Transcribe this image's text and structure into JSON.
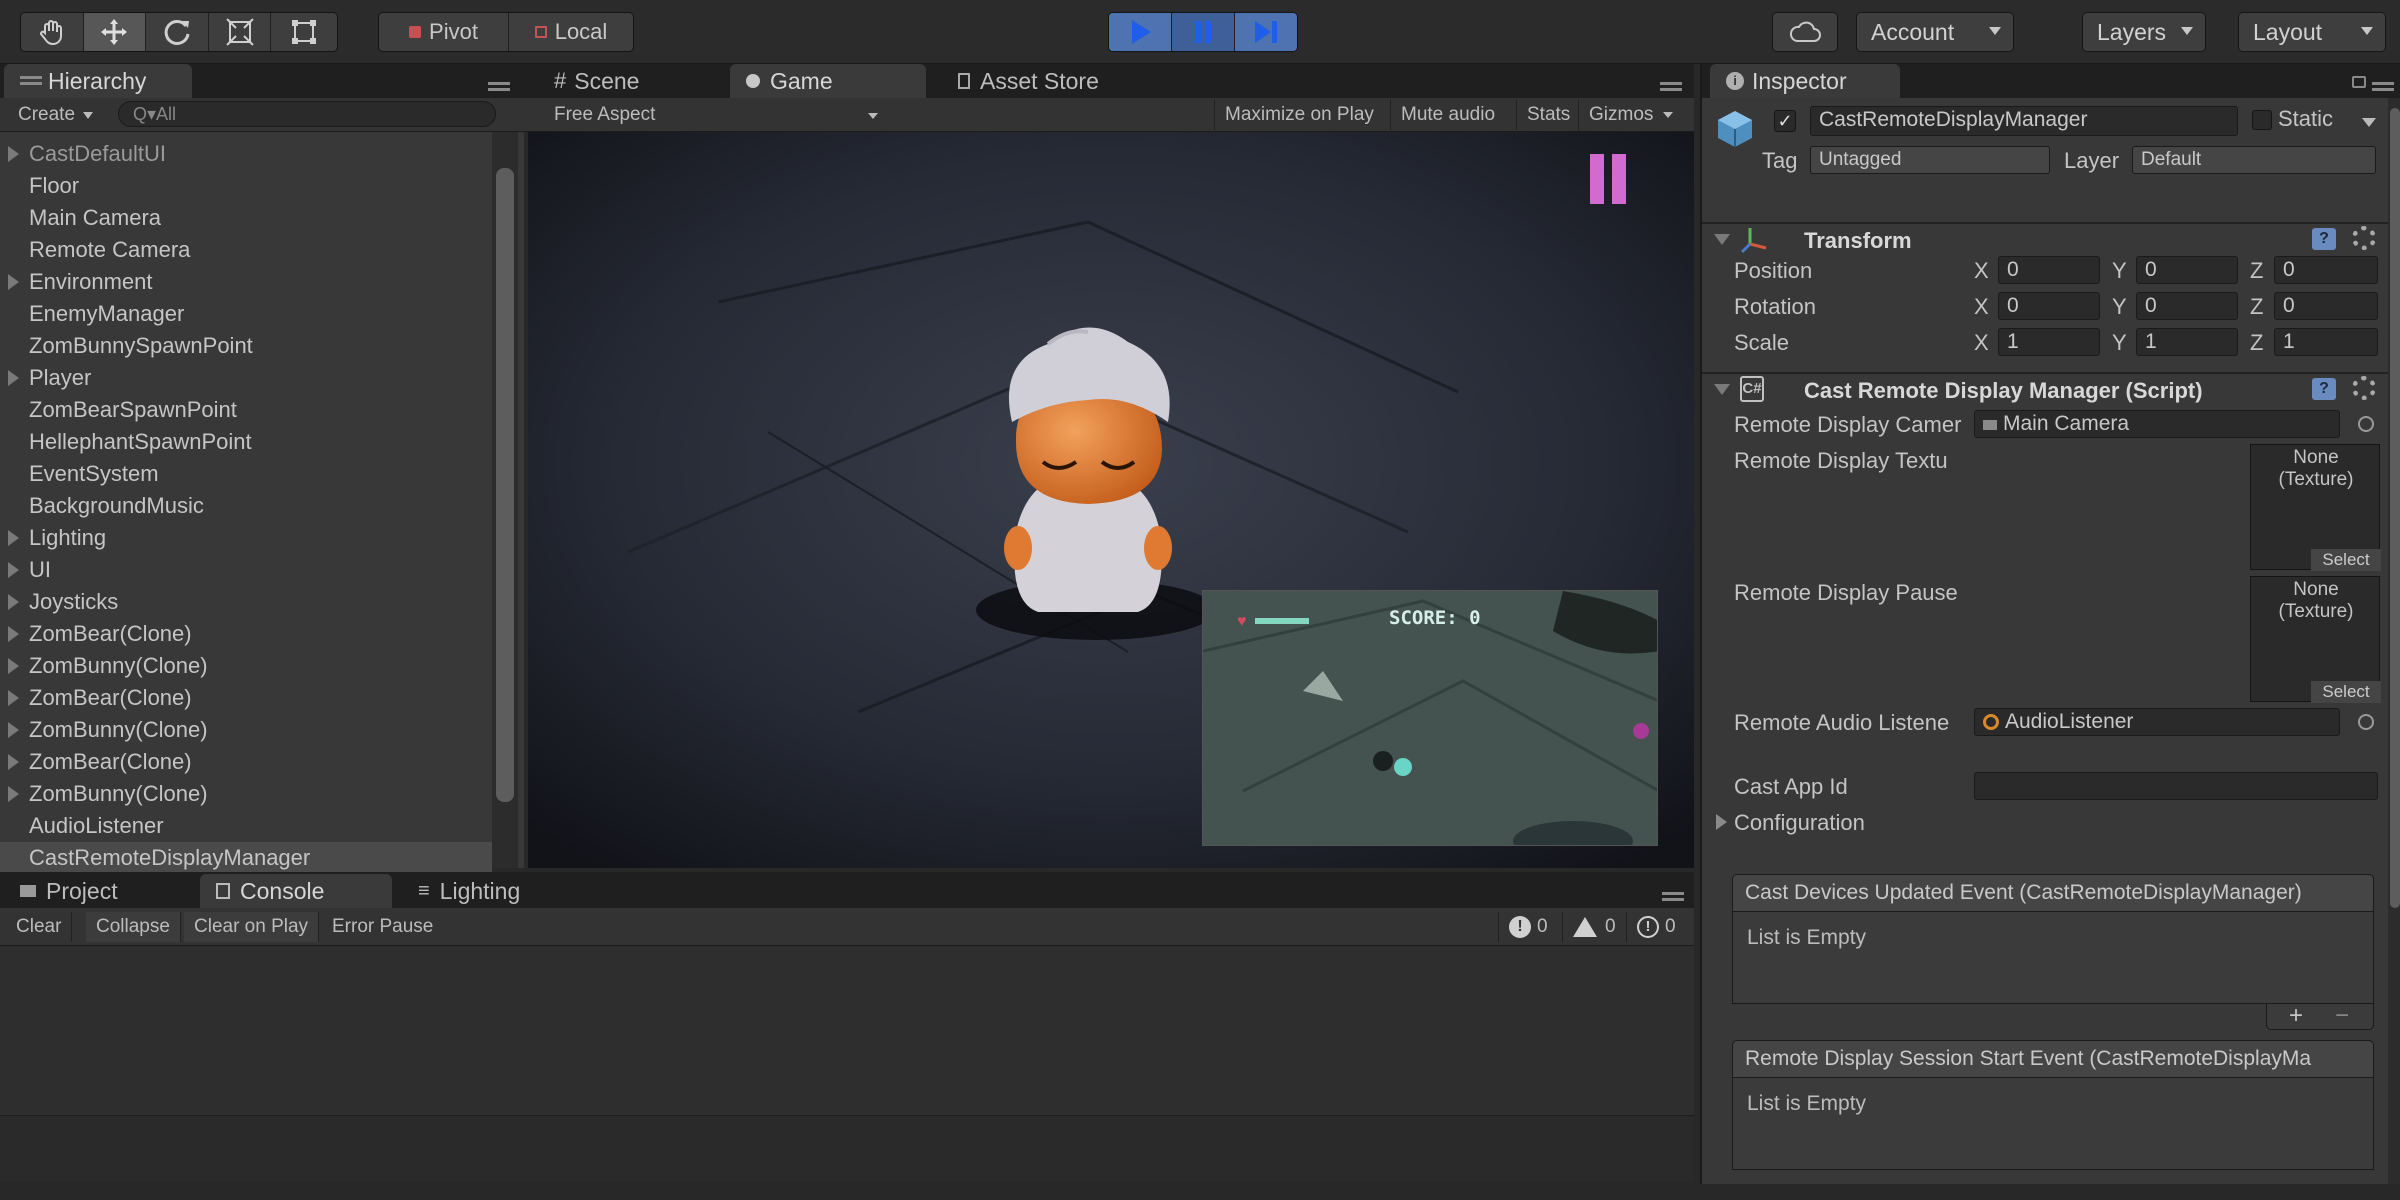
{
  "toolbar": {
    "pivot_label": "Pivot",
    "local_label": "Local",
    "account_label": "Account",
    "layers_label": "Layers",
    "layout_label": "Layout",
    "tools": [
      "hand-tool-icon",
      "move-tool-icon",
      "rotate-tool-icon",
      "scale-tool-icon",
      "rect-tool-icon"
    ],
    "play_icon": "play-icon",
    "pause_icon": "pause-icon",
    "step_icon": "step-icon",
    "cloud_icon": "cloud-icon"
  },
  "hierarchy": {
    "tab_label": "Hierarchy",
    "create_label": "Create",
    "search_placeholder": "Q▾All",
    "items": [
      {
        "label": "CastDefaultUI",
        "expandable": true,
        "dim": true
      },
      {
        "label": "Floor",
        "expandable": false
      },
      {
        "label": "Main Camera",
        "expandable": false
      },
      {
        "label": "Remote Camera",
        "expandable": false
      },
      {
        "label": "Environment",
        "expandable": true
      },
      {
        "label": "EnemyManager",
        "expandable": false
      },
      {
        "label": "ZomBunnySpawnPoint",
        "expandable": false
      },
      {
        "label": "Player",
        "expandable": true
      },
      {
        "label": "ZomBearSpawnPoint",
        "expandable": false
      },
      {
        "label": "HellephantSpawnPoint",
        "expandable": false
      },
      {
        "label": "EventSystem",
        "expandable": false
      },
      {
        "label": "BackgroundMusic",
        "expandable": false
      },
      {
        "label": "Lighting",
        "expandable": true
      },
      {
        "label": "UI",
        "expandable": true
      },
      {
        "label": "Joysticks",
        "expandable": true
      },
      {
        "label": "ZomBear(Clone)",
        "expandable": true
      },
      {
        "label": "ZomBunny(Clone)",
        "expandable": true
      },
      {
        "label": "ZomBear(Clone)",
        "expandable": true
      },
      {
        "label": "ZomBunny(Clone)",
        "expandable": true
      },
      {
        "label": "ZomBear(Clone)",
        "expandable": true
      },
      {
        "label": "ZomBunny(Clone)",
        "expandable": true
      },
      {
        "label": "AudioListener",
        "expandable": false
      },
      {
        "label": "CastRemoteDisplayManager",
        "expandable": false,
        "selected": true
      }
    ]
  },
  "center": {
    "tabs": [
      {
        "label": "Scene",
        "icon": "scene-icon"
      },
      {
        "label": "Game",
        "icon": "game-icon",
        "active": true
      },
      {
        "label": "Asset Store",
        "icon": "store-icon"
      }
    ],
    "aspect_label": "Free Aspect",
    "maximize_label": "Maximize on Play",
    "mute_label": "Mute audio",
    "stats_label": "Stats",
    "gizmos_label": "Gizmos",
    "inset_score": "SCORE: 0",
    "inset_health": 0.9
  },
  "console": {
    "tabs": [
      {
        "label": "Project",
        "icon": "folder-icon"
      },
      {
        "label": "Console",
        "icon": "console-icon",
        "active": true
      },
      {
        "label": "Lighting",
        "icon": "lighting-icon"
      }
    ],
    "buttons": [
      "Clear",
      "Collapse",
      "Clear on Play",
      "Error Pause"
    ],
    "counts": {
      "info": "0",
      "warning": "0",
      "error": "0"
    }
  },
  "inspector": {
    "tab_label": "Inspector",
    "object_name": "CastRemoteDisplayManager",
    "static_label": "Static",
    "tag_label": "Tag",
    "tag_value": "Untagged",
    "layer_label": "Layer",
    "layer_value": "Default",
    "transform": {
      "title": "Transform",
      "rows": [
        {
          "label": "Position",
          "x": "0",
          "y": "0",
          "z": "0"
        },
        {
          "label": "Rotation",
          "x": "0",
          "y": "0",
          "z": "0"
        },
        {
          "label": "Scale",
          "x": "1",
          "y": "1",
          "z": "1"
        }
      ],
      "axis_x": "X",
      "axis_y": "Y",
      "axis_z": "Z"
    },
    "script": {
      "title": "Cast Remote Display Manager (Script)",
      "remote_camera_label": "Remote Display Camer",
      "remote_camera_value": "Main Camera",
      "remote_texture_label": "Remote Display Textu",
      "remote_pause_label": "Remote Display Pause",
      "texture_none": "None",
      "texture_type": "(Texture)",
      "select_label": "Select",
      "audio_label": "Remote Audio Listene",
      "audio_value": "AudioListener",
      "app_id_label": "Cast App Id",
      "app_id_value": "",
      "config_label": "Configuration",
      "event1_title": "Cast Devices Updated Event (CastRemoteDisplayManager)",
      "event2_title": "Remote Display Session Start Event (CastRemoteDisplayMa",
      "list_empty": "List is Empty",
      "plus": "+",
      "minus": "−"
    }
  },
  "colors": {
    "play_active": "#4a6fb0",
    "pause_glyph": "#d36ad0",
    "selection": "#3a3a3a"
  }
}
